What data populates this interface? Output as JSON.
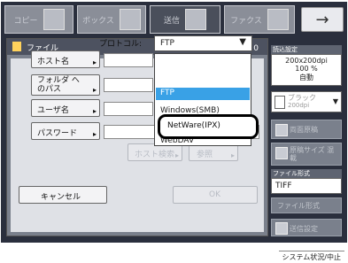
{
  "tabs": [
    {
      "label": "コピー"
    },
    {
      "label": "ボックス"
    },
    {
      "label": "送信"
    },
    {
      "label": "ファクス"
    }
  ],
  "next_button": {
    "icon": "right-arrow-icon",
    "label": "→"
  },
  "dialog": {
    "title": "ファイル",
    "destination_count": "宛先数 : 0",
    "protocol_label": "プロトコル:",
    "protocol_value": "FTP",
    "protocol_options": [
      "FTP",
      "Windows(SMB)",
      "NetWare(IPX)",
      "WebDAV"
    ],
    "highlighted_option": "NetWare(IPX)",
    "fields": [
      {
        "label": "ホスト名",
        "value": ""
      },
      {
        "label": "フォルダ へのパス",
        "value": ""
      },
      {
        "label": "ユーザ名",
        "value": ""
      },
      {
        "label": "パスワード",
        "value": ""
      }
    ],
    "host_search_label": "ホスト検索",
    "reference_label": "参照",
    "cancel_label": "キャンセル",
    "ok_label": "OK"
  },
  "side": {
    "read_settings_header": "読込設定",
    "resolution": "200x200dpi",
    "zoom": "100 %",
    "auto": "自動",
    "color_mode_label": "ブラック",
    "color_mode_sub": "200dpi",
    "duplex_label": "両面原稿",
    "different_size_label": "原稿サイズ 混載",
    "file_format_header": "ファイル形式",
    "file_format_value": "TIFF",
    "file_format_button": "ファイル形式",
    "send_settings_button": "送信設定"
  },
  "status_bar": {
    "label": "システム状況/中止"
  },
  "colors": {
    "selected_option": "#39a1e6",
    "header_bg": "#4d5260",
    "device_bg": "#2a2f3d"
  }
}
